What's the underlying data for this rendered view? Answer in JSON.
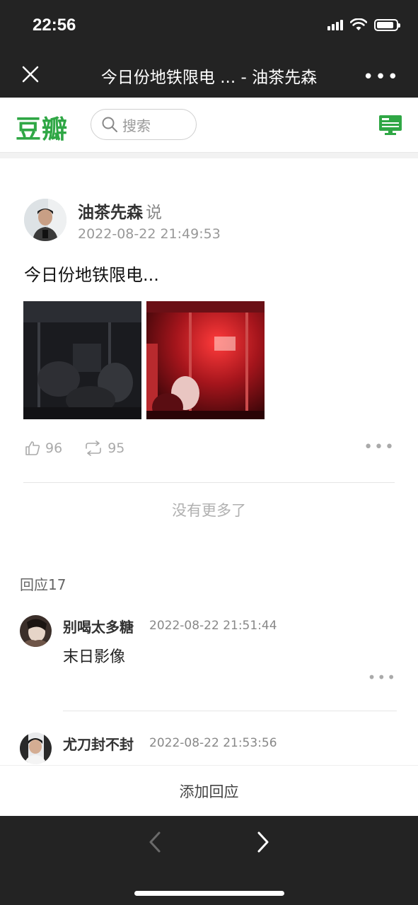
{
  "status_bar": {
    "time": "22:56"
  },
  "titlebar": {
    "title": "今日份地铁限电 ... - 油茶先森",
    "more_label": "•••"
  },
  "header": {
    "logo": "豆瓣",
    "search_placeholder": "搜索"
  },
  "post": {
    "author": "油茶先森",
    "said": "说",
    "time": "2022-08-22 21:49:53",
    "text": "今日份地铁限电...",
    "likes": "96",
    "reshares": "95",
    "more_label": "•••",
    "no_more": "没有更多了"
  },
  "replies": {
    "title": "回应17",
    "items": [
      {
        "name": "别喝太多糖",
        "time": "2022-08-22 21:51:44",
        "text": "末日影像",
        "more_label": "•••"
      },
      {
        "name": "尤刀封不封",
        "time": "2022-08-22 21:53:56",
        "text": ""
      }
    ]
  },
  "bottom": {
    "add_reply": "添加回应"
  },
  "colors": {
    "brand": "#2fa745",
    "dark_bar": "#232323"
  }
}
